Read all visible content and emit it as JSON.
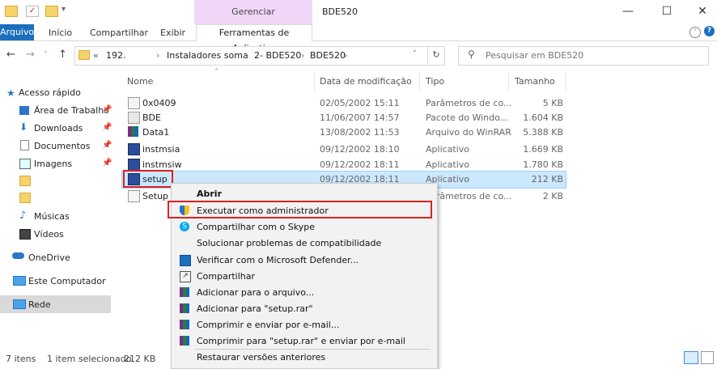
{
  "window": {
    "title": "BDE520",
    "contextual_group": "Gerenciar"
  },
  "ribbon": {
    "tabs": [
      "Arquivo",
      "Início",
      "Compartilhar",
      "Exibir",
      "Ferramentas de Aplicativo"
    ]
  },
  "address": {
    "prefix": "«",
    "crumbs": [
      "192.",
      "Instaladores soma",
      "2- BDE520",
      "BDE520"
    ],
    "separator": "›"
  },
  "search": {
    "placeholder": "Pesquisar em BDE520"
  },
  "sidebar": {
    "items": [
      {
        "label": "Acesso rápido"
      },
      {
        "label": "Área de Trabalho"
      },
      {
        "label": "Downloads"
      },
      {
        "label": "Documentos"
      },
      {
        "label": "Imagens"
      },
      {
        "label": ""
      },
      {
        "label": ""
      },
      {
        "label": "Músicas"
      },
      {
        "label": "Vídeos"
      },
      {
        "label": "OneDrive"
      },
      {
        "label": "Este Computador"
      },
      {
        "label": "Rede"
      }
    ]
  },
  "columns": {
    "name": "Nome",
    "date": "Data de modificação",
    "type": "Tipo",
    "size": "Tamanho"
  },
  "files": [
    {
      "name": "0x0409",
      "date": "02/05/2002 15:11",
      "type": "Parâmetros de co...",
      "size": "5 KB"
    },
    {
      "name": "BDE",
      "date": "11/06/2007 14:57",
      "type": "Pacote do Windo...",
      "size": "1.604 KB"
    },
    {
      "name": "Data1",
      "date": "13/08/2002 11:53",
      "type": "Arquivo do WinRAR",
      "size": "5.388 KB"
    },
    {
      "name": "instmsia",
      "date": "09/12/2002 18:10",
      "type": "Aplicativo",
      "size": "1.669 KB"
    },
    {
      "name": "instmsiw",
      "date": "09/12/2002 18:11",
      "type": "Aplicativo",
      "size": "1.780 KB"
    },
    {
      "name": "setup",
      "date": "09/12/2002 18:11",
      "type": "Aplicativo",
      "size": "212 KB"
    },
    {
      "name": "Setup",
      "date": "",
      "type": "Parâmetros de co...",
      "size": "2 KB"
    }
  ],
  "context_menu": {
    "items": [
      "Abrir",
      "Executar como administrador",
      "Compartilhar com o Skype",
      "Solucionar problemas de compatibilidade",
      "Verificar com o Microsoft Defender...",
      "Compartilhar",
      "Adicionar para o arquivo...",
      "Adicionar para \"setup.rar\"",
      "Comprimir e enviar por e-mail...",
      "Comprimir para \"setup.rar\" e enviar por e-mail",
      "Restaurar versões anteriores"
    ]
  },
  "status": {
    "count": "7 itens",
    "selected": "1 item selecionado",
    "size": "212 KB"
  },
  "colors": {
    "accent": "#1a6fbf",
    "selection": "#cce8ff",
    "highlight_box": "#e02020",
    "context_group": "#f0d7f8"
  }
}
